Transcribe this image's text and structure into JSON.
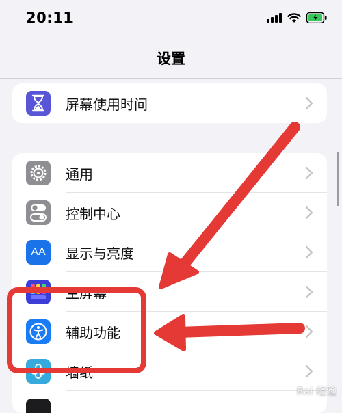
{
  "status_bar": {
    "time": "20:11",
    "signal_icon": "cellular-signal-icon",
    "wifi_icon": "wifi-icon",
    "battery_icon": "battery-charging-icon",
    "battery_color": "#34c759"
  },
  "nav": {
    "title": "设置"
  },
  "group1": {
    "items": [
      {
        "label": "屏幕使用时间",
        "icon": "hourglass-icon",
        "color": "#5856d6"
      }
    ]
  },
  "group2": {
    "items": [
      {
        "label": "通用",
        "icon": "gear-icon",
        "color": "#8e8e93"
      },
      {
        "label": "控制中心",
        "icon": "toggle-switches-icon",
        "color": "#8e8e93"
      },
      {
        "label": "显示与亮度",
        "icon": "text-size-icon",
        "color": "#1a73e8",
        "icon_text": "AA"
      },
      {
        "label": "主屏幕",
        "icon": "home-screen-grid-icon",
        "color": "#3b3fd8"
      },
      {
        "label": "辅助功能",
        "icon": "accessibility-icon",
        "color": "#1a7cf5"
      },
      {
        "label": "墙纸",
        "icon": "flower-icon",
        "color": "#36aadc"
      }
    ]
  },
  "annotation": {
    "arrow_color": "#e53935",
    "highlight_box_color": "#e53935"
  },
  "watermark": {
    "text": "Bai 经验"
  }
}
